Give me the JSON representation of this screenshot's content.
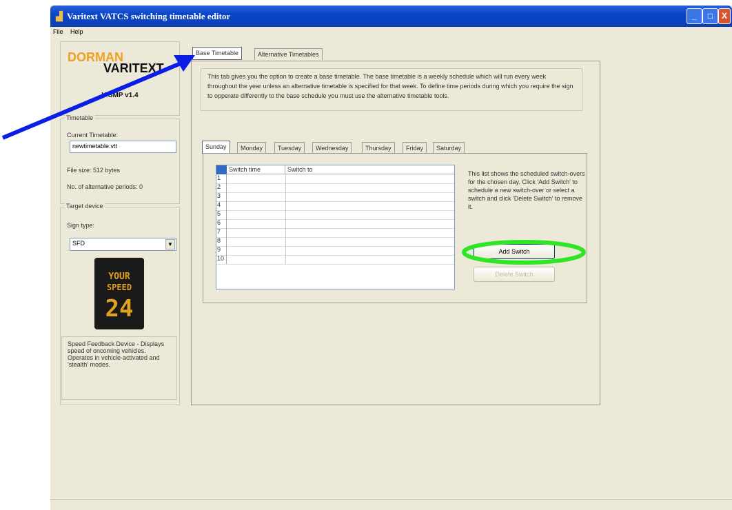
{
  "window": {
    "title": "Varitext VATCS switching timetable editor",
    "controls": {
      "minimize": "_",
      "maximize": "□",
      "close": "X"
    }
  },
  "menu": [
    "File",
    "Help"
  ],
  "logo": {
    "brand_top": "DORMAN",
    "brand_bottom": "VARITEXT",
    "version": "V-SMP v1.4"
  },
  "timetable": {
    "group_title": "Timetable",
    "current_label": "Current Timetable:",
    "current_value": "newtimetable.vtt",
    "file_size": "File size:  512 bytes",
    "alt_periods": "No. of alternative periods:  0"
  },
  "target": {
    "group_title": "Target device",
    "sign_type_label": "Sign type:",
    "sign_type_value": "SFD",
    "device_text": [
      "YOUR",
      "SPEED",
      "24"
    ],
    "description": "Speed Feedback Device - Displays speed of oncoming vehicles. Operates in vehicle-activated and 'stealth' modes."
  },
  "main_tabs": [
    "Base Timetable",
    "Alternative Timetables"
  ],
  "info_text": "This tab gives you the option to create a base timetable. The base timetable is a weekly schedule which will run every week throughout the year unless an alternative timetable is specified for that week. To define time periods during which you require the sign to opperate differently to the base schedule you must use the alternative timetable tools.",
  "day_tabs": [
    "Sunday",
    "Monday",
    "Tuesday",
    "Wednesday",
    "Thursday",
    "Friday",
    "Saturday"
  ],
  "grid": {
    "columns": [
      "Switch time",
      "Switch to"
    ],
    "rows": [
      "1",
      "2",
      "3",
      "4",
      "5",
      "6",
      "7",
      "8",
      "9",
      "10"
    ]
  },
  "help_text": "This list shows the scheduled switch-overs for the chosen day. Click 'Add Switch' to schedule a new switch-over or select a switch and click 'Delete Switch' to remove it.",
  "buttons": {
    "add": "Add Switch",
    "delete": "Delete Switch"
  },
  "annotation_colors": {
    "arrow": "#0a1ee6",
    "highlight": "#2ee626"
  }
}
